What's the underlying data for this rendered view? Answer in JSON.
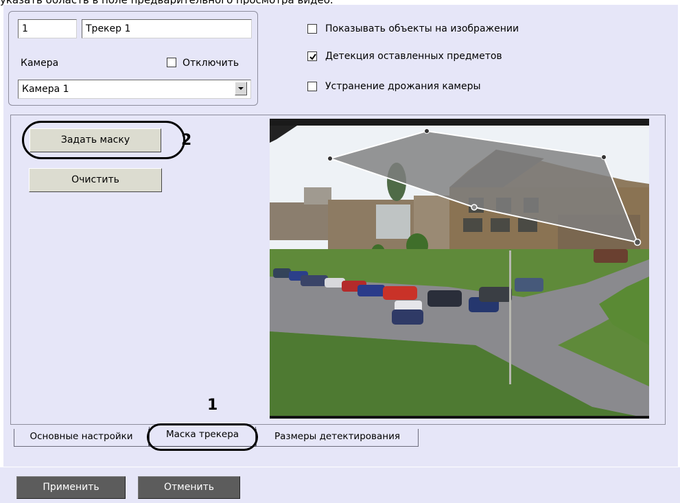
{
  "intro_text": "указать область в поле предварительного просмотра видео.",
  "tracker": {
    "id": "1",
    "name": "Трекер 1"
  },
  "camera": {
    "label": "Камера",
    "disable_label": "Отключить",
    "disable_checked": false,
    "selected": "Камера 1"
  },
  "options": [
    {
      "label": "Показывать объекты на изображении",
      "checked": false
    },
    {
      "label": "Детекция оставленных предметов",
      "checked": true
    },
    {
      "label": "Устранение дрожания камеры",
      "checked": false
    }
  ],
  "mask": {
    "set_mask_label": "Задать маску",
    "clear_label": "Очистить"
  },
  "tabs": [
    {
      "label": "Основные настройки",
      "active": false
    },
    {
      "label": "Маска трекера",
      "active": true
    },
    {
      "label": "Размеры детектирования",
      "active": false
    }
  ],
  "callouts": {
    "one": "1",
    "two": "2"
  },
  "footer": {
    "apply_label": "Применить",
    "cancel_label": "Отменить"
  },
  "colors": {
    "panel_bg": "#e6e6f8",
    "mask_fill": "#7f7f7f",
    "dark_button": "#5c5c5c"
  }
}
